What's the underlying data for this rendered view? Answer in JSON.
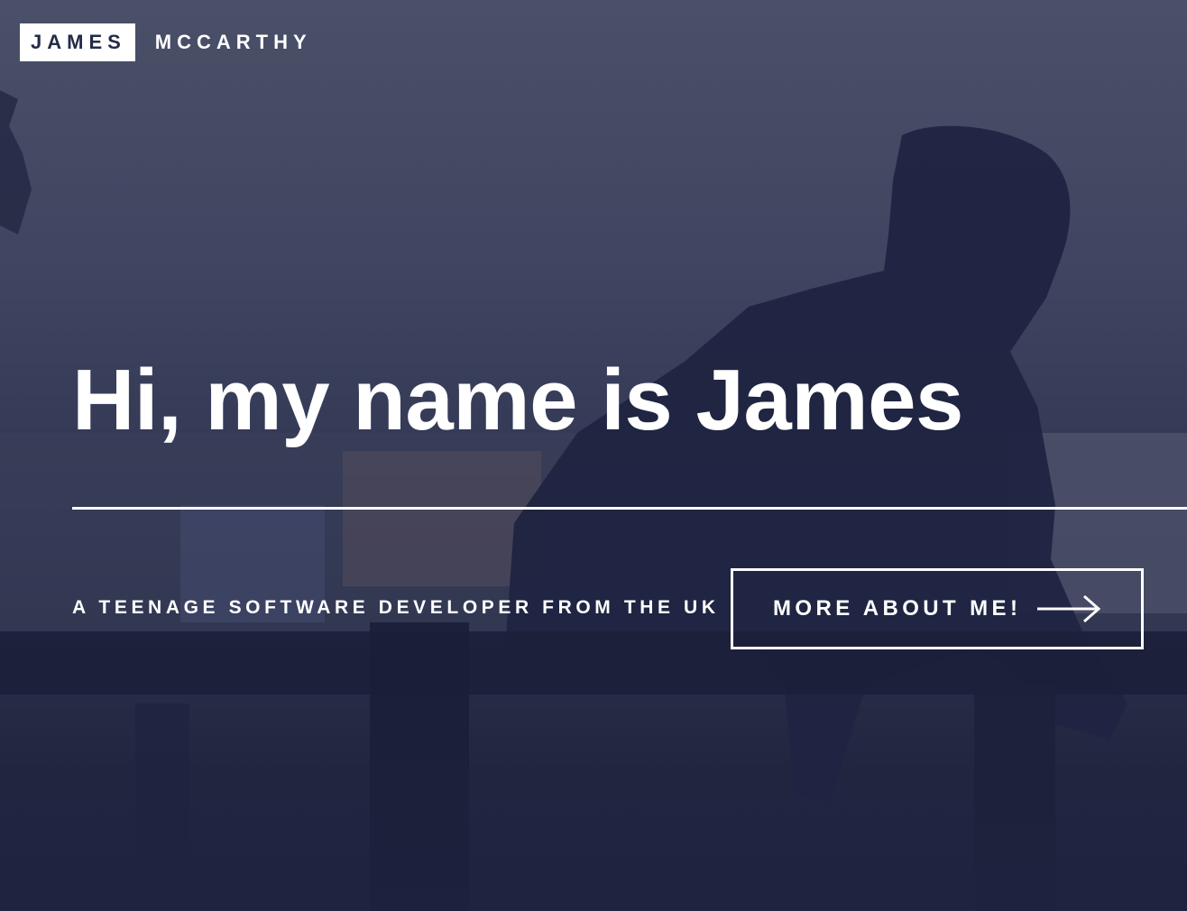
{
  "logo": {
    "first": "JAMES",
    "last": "MCCARTHY"
  },
  "hero": {
    "headline": "Hi, my name is James",
    "tagline": "A TEENAGE SOFTWARE DEVELOPER FROM THE UK",
    "cta_label": "MORE ABOUT ME!",
    "cta_icon": "arrow-right-icon",
    "background_image": "silhouette of a boy leaning on a wooden fence"
  },
  "colors": {
    "overlay": "#2a2f4c",
    "text": "#ffffff",
    "logo_text": "#242a48"
  }
}
